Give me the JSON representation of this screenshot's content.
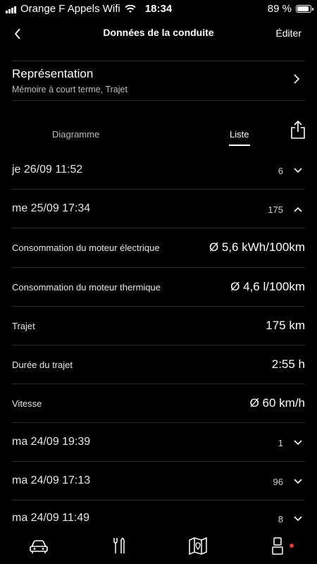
{
  "status_bar": {
    "carrier": "Orange F Appels Wifi",
    "time": "18:34",
    "battery": "89 %",
    "battery_level": 0.89
  },
  "nav": {
    "title": "Données de la conduite",
    "edit_label": "Éditer"
  },
  "representation": {
    "title": "Représentation",
    "subtitle": "Mémoire à court terme, Trajet"
  },
  "tabs": {
    "diagram_label": "Diagramme",
    "list_label": "Liste",
    "active": "Liste"
  },
  "trips": [
    {
      "date": "je 26/09 11:52",
      "count": "6",
      "expanded": false
    },
    {
      "date": "me 25/09 17:34",
      "count": "175",
      "expanded": true
    },
    {
      "date": "ma 24/09 19:39",
      "count": "1",
      "expanded": false
    },
    {
      "date": "ma 24/09 17:13",
      "count": "96",
      "expanded": false
    },
    {
      "date": "ma 24/09 11:49",
      "count": "8",
      "expanded": false
    }
  ],
  "details": [
    {
      "label": "Consommation du moteur électrique",
      "value": "Ø 5,6 kWh/100km"
    },
    {
      "label": "Consommation du moteur thermique",
      "value": "Ø 4,6 l/100km"
    },
    {
      "label": "Trajet",
      "value": "175 km"
    },
    {
      "label": "Durée du trajet",
      "value": "2:55 h"
    },
    {
      "label": "Vitesse",
      "value": "Ø 60 km/h"
    }
  ],
  "tab_bar": {
    "items": [
      "car-icon",
      "tools-icon",
      "map-icon",
      "profile-icon"
    ],
    "notification_color": "#e53935"
  }
}
